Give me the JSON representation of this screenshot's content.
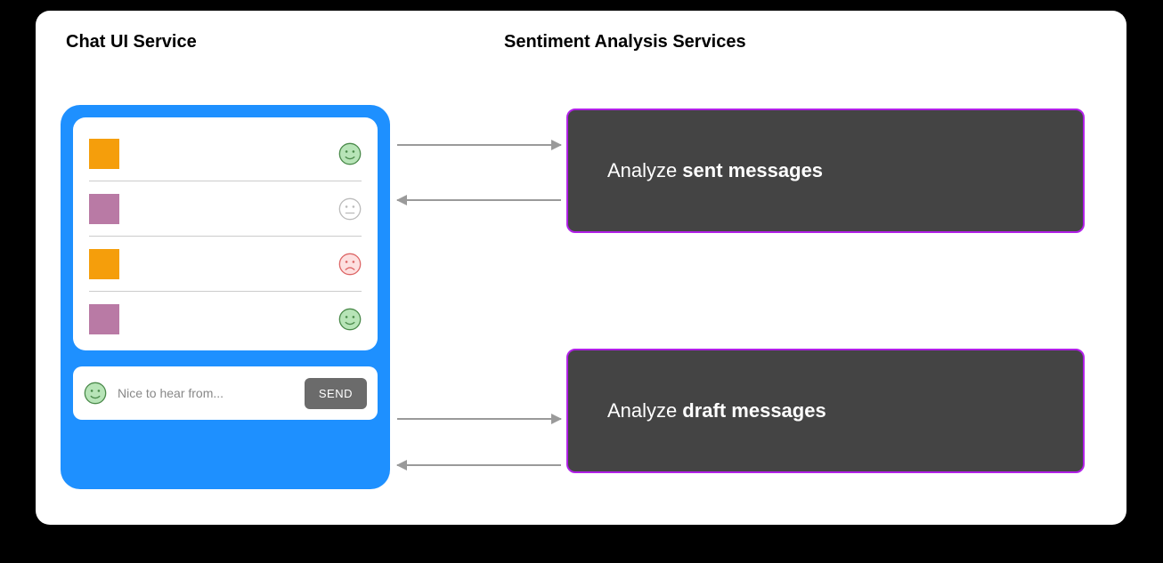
{
  "titles": {
    "left": "Chat UI Service",
    "right": "Sentiment Analysis Services"
  },
  "chat": {
    "messages": [
      {
        "avatar_color": "orange",
        "sentiment": "happy"
      },
      {
        "avatar_color": "mauve",
        "sentiment": "neutral"
      },
      {
        "avatar_color": "orange",
        "sentiment": "sad"
      },
      {
        "avatar_color": "mauve",
        "sentiment": "happy"
      }
    ],
    "compose": {
      "sentiment": "happy",
      "text": "Nice to hear from...",
      "send_label": "SEND"
    }
  },
  "services": {
    "sent": {
      "prefix": "Analyze",
      "bold": "sent messages"
    },
    "draft": {
      "prefix": "Analyze",
      "bold": "draft messages"
    }
  },
  "colors": {
    "panel_blue": "#1e90ff",
    "service_border": "#b020e6",
    "service_bg": "#444444",
    "avatar_orange": "#f59e0b",
    "avatar_mauve": "#b97aa5",
    "happy": "#7fc97f",
    "neutral": "#bdbdbd",
    "sad": "#e06666"
  }
}
